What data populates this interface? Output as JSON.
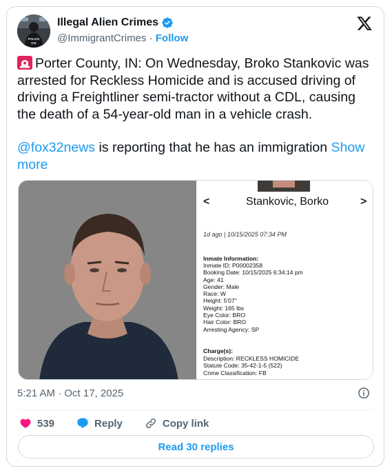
{
  "header": {
    "display_name": "Illegal Alien Crimes",
    "handle": "@ImmigrantCrimes",
    "separator": "·",
    "follow_label": "Follow",
    "avatar_text": "POLICE ICE"
  },
  "tweet": {
    "line1": "Porter County, IN: On Wednesday, Broko Stankovic was arrested for Reckless Homicide and is accused driving of driving a Freightliner semi-tractor without a CDL, causing the death of a 54-year-old man in a vehicle crash.",
    "mention": "@fox32news",
    "line2": " is reporting that he has an immigration ",
    "show_more": "Show more"
  },
  "media": {
    "doc": {
      "nav_left": "<",
      "nav_right": ">",
      "title": "Stankovic, Borko",
      "meta": "1d ago | 10/15/2025 07:34 PM",
      "inmate_heading": "Inmate Information:",
      "inmate_lines": [
        "Inmate ID: P00002358",
        "Booking Date: 10/15/2025 6:34:14 pm",
        "Age: 41",
        "Gender: Male",
        "Race: W",
        "Height: 5'07\"",
        "Weight: 165 lbs",
        "Eye Color: BRO",
        "Hair Color: BRO",
        "Arresting Agency: SP"
      ],
      "charges_heading": "Charge(s):",
      "charge_lines": [
        "Description: RECKLESS HOMICIDE",
        "Statute Code: 35-42-1-5 (522)",
        "Crime Classification: FB"
      ]
    }
  },
  "timestamp": "5:21 AM · Oct 17, 2025",
  "actions": {
    "likes": "539",
    "reply_label": "Reply",
    "copy_label": "Copy link"
  },
  "replies_button": "Read 30 replies",
  "colors": {
    "accent": "#1d9bf0",
    "like": "#f91880",
    "text": "#0f1419",
    "secondary": "#536471",
    "border": "#cfd9de"
  },
  "icons": [
    "siren-icon",
    "verified-badge-icon",
    "x-logo-icon",
    "info-icon",
    "heart-icon",
    "reply-bubble-icon",
    "link-icon"
  ]
}
